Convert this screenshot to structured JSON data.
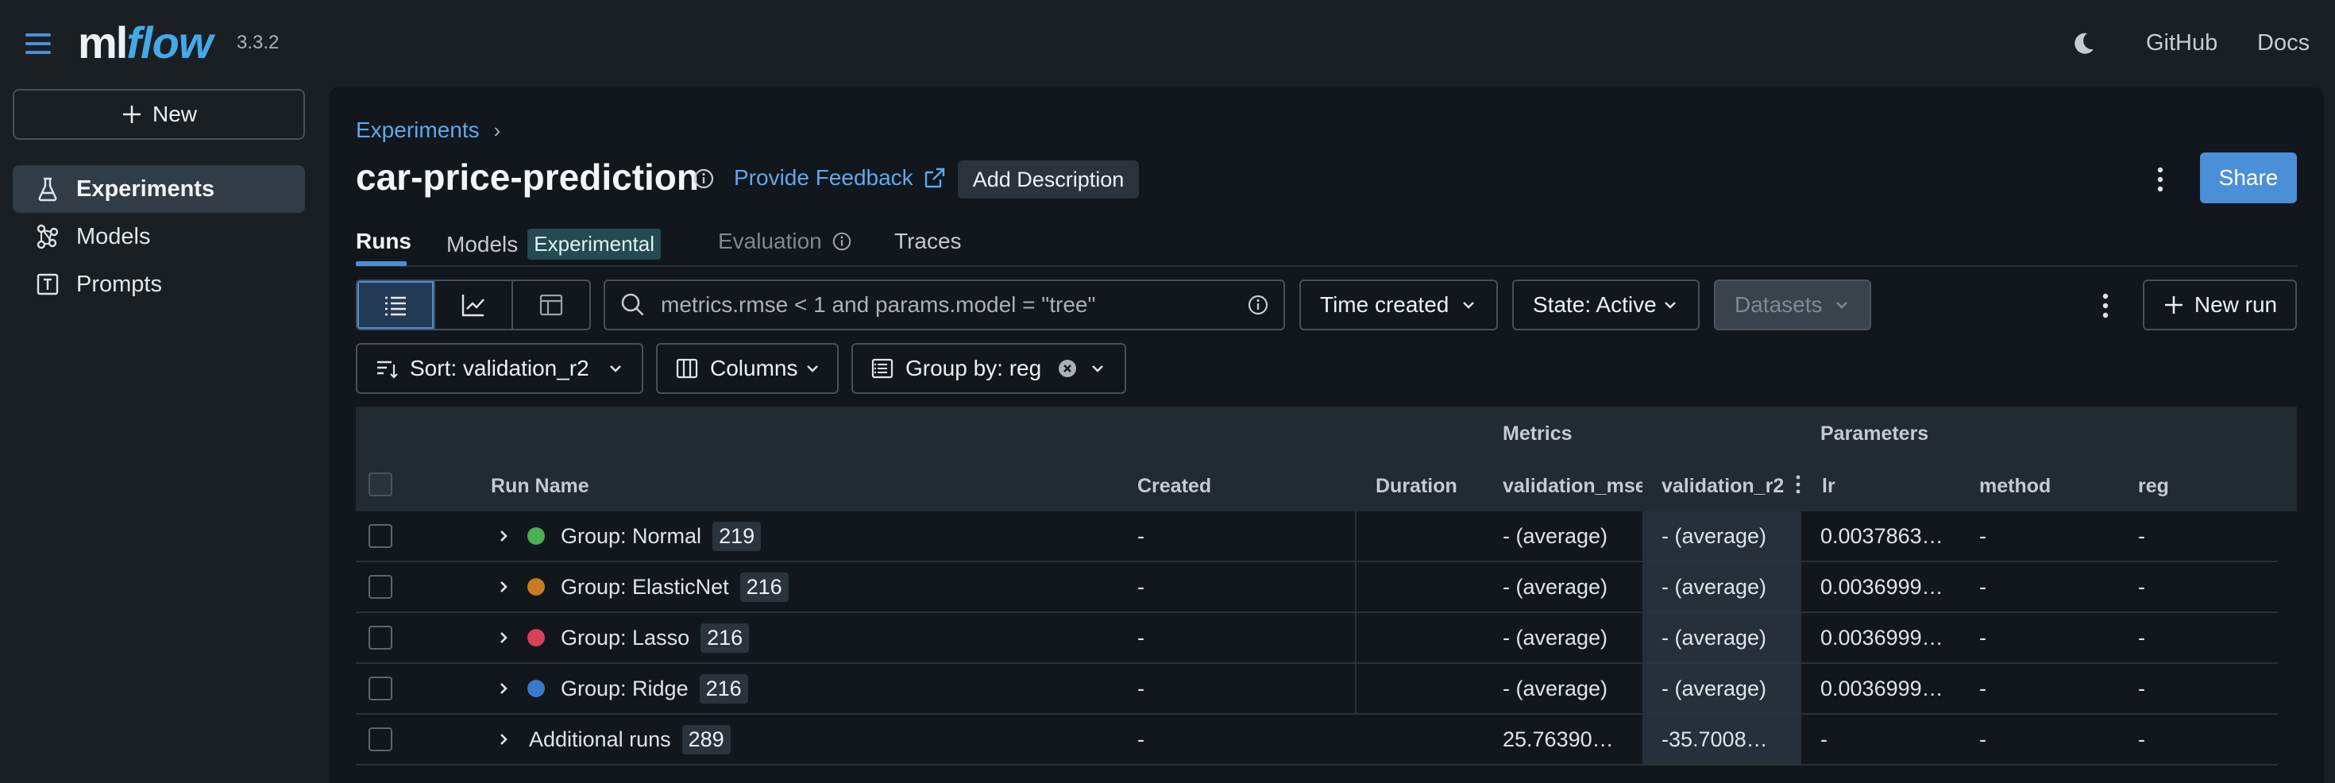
{
  "app": {
    "logo_ml": "ml",
    "logo_flow": "flow",
    "version": "3.3.2",
    "github_label": "GitHub",
    "docs_label": "Docs",
    "accent_color": "#4a8fd8"
  },
  "sidebar": {
    "new_label": "New",
    "items": [
      {
        "label": "Experiments",
        "icon": "beaker-icon",
        "active": true
      },
      {
        "label": "Models",
        "icon": "models-icon",
        "active": false
      },
      {
        "label": "Prompts",
        "icon": "prompts-icon",
        "active": false
      }
    ]
  },
  "header": {
    "breadcrumb": "Experiments",
    "title": "car-price-prediction",
    "feedback_label": "Provide Feedback",
    "add_description_label": "Add Description",
    "share_label": "Share"
  },
  "tabs": [
    {
      "label": "Runs",
      "state": "active"
    },
    {
      "label": "Models",
      "badge": "Experimental",
      "state": "normal"
    },
    {
      "label": "Evaluation",
      "state": "disabled"
    },
    {
      "label": "Traces",
      "state": "normal"
    }
  ],
  "toolbar": {
    "search_placeholder": "metrics.rmse < 1 and params.model = \"tree\"",
    "time_created_label": "Time created",
    "state_label": "State: Active",
    "datasets_label": "Datasets",
    "new_run_label": "New run",
    "sort_label": "Sort: validation_r2",
    "columns_label": "Columns",
    "group_by_label": "Group by: reg"
  },
  "table": {
    "group_headers": {
      "metrics": "Metrics",
      "parameters": "Parameters"
    },
    "columns": [
      "Run Name",
      "Created",
      "Duration",
      "validation_mse",
      "validation_r2",
      "lr",
      "method",
      "reg"
    ],
    "rows": [
      {
        "name": "Group: Normal",
        "count": "219",
        "color": "#4caf50",
        "created": "-",
        "duration": "",
        "validation_mse": "- (average)",
        "validation_r2": "- (average)",
        "lr": "0.0037863…",
        "method": "-",
        "reg": "-"
      },
      {
        "name": "Group: ElasticNet",
        "count": "216",
        "color": "#c77d1f",
        "created": "-",
        "duration": "",
        "validation_mse": "- (average)",
        "validation_r2": "- (average)",
        "lr": "0.0036999…",
        "method": "-",
        "reg": "-"
      },
      {
        "name": "Group: Lasso",
        "count": "216",
        "color": "#d94157",
        "created": "-",
        "duration": "",
        "validation_mse": "- (average)",
        "validation_r2": "- (average)",
        "lr": "0.0036999…",
        "method": "-",
        "reg": "-"
      },
      {
        "name": "Group: Ridge",
        "count": "216",
        "color": "#3a78c9",
        "created": "-",
        "duration": "",
        "validation_mse": "- (average)",
        "validation_r2": "- (average)",
        "lr": "0.0036999…",
        "method": "-",
        "reg": "-"
      },
      {
        "name": "Additional runs",
        "count": "289",
        "color": "",
        "created": "-",
        "duration": "",
        "validation_mse": "25.76390…",
        "validation_r2": "-35.7008…",
        "lr": "-",
        "method": "-",
        "reg": "-"
      }
    ]
  }
}
